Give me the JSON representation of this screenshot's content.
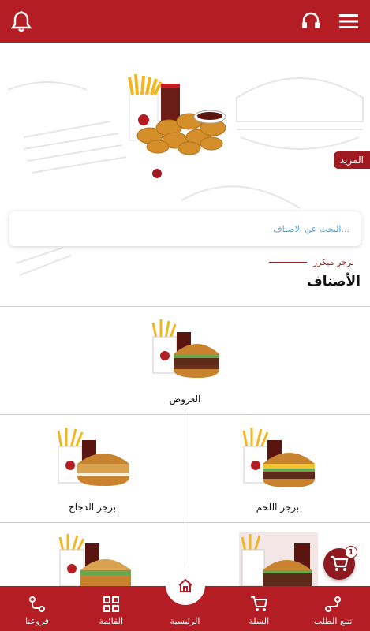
{
  "header": {
    "menu_icon": "hamburger-menu-icon",
    "support_icon": "headset-icon",
    "notification_icon": "bell-icon"
  },
  "banner": {
    "more_label": "المزيد",
    "slide_index": 1
  },
  "search": {
    "placeholder": "البحث عن الاصناف..."
  },
  "brand": {
    "name": "برجر ميكرز"
  },
  "categories": {
    "title": "الأصناف",
    "items": [
      {
        "label": "العروض"
      },
      {
        "label": "برجر اللحم"
      },
      {
        "label": "برجر الدجاج"
      },
      {
        "label": ""
      },
      {
        "label": ""
      }
    ]
  },
  "cart_fab": {
    "count": "1"
  },
  "bottom_nav": {
    "items": [
      {
        "label": "تتبع الطلب",
        "icon": "route-icon"
      },
      {
        "label": "السلة",
        "icon": "cart-icon"
      },
      {
        "label": "الرئيسية",
        "icon": "home-icon"
      },
      {
        "label": "القائمة",
        "icon": "grid-icon"
      },
      {
        "label": "فروعنا",
        "icon": "location-route-icon"
      }
    ]
  },
  "colors": {
    "primary": "#b51d24",
    "accent": "#a01b21",
    "search_placeholder": "#4aa4d8"
  }
}
